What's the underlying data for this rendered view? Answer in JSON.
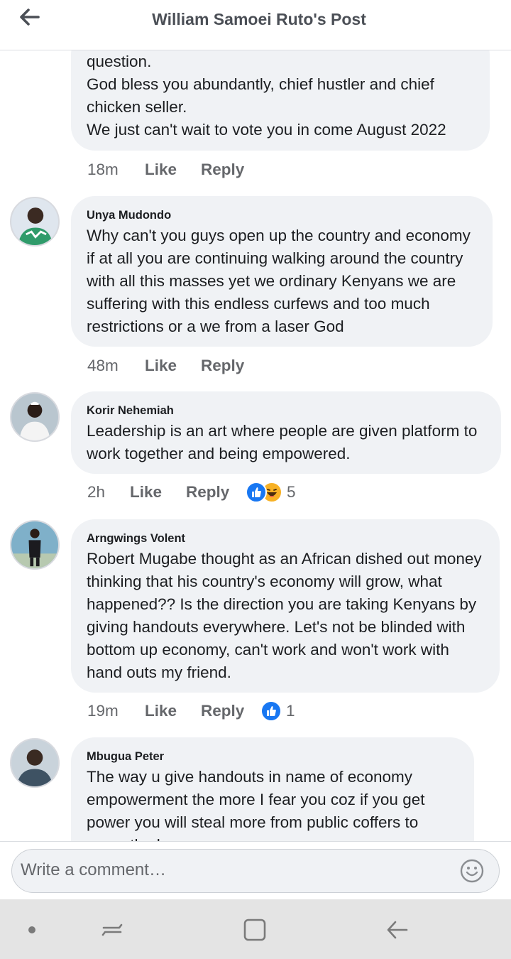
{
  "header": {
    "title": "William Samoei Ruto's Post"
  },
  "comments": [
    {
      "name": "",
      "text": "question.\nGod bless you abundantly, chief hustler and chief chicken seller.\nWe just can't wait to vote you in come August 2022",
      "time": "18m",
      "like": "Like",
      "reply": "Reply",
      "reaction_count": ""
    },
    {
      "name": "Unya Mudondo",
      "text": "Why can't you guys open up the country and economy if at all you are continuing walking around the country with all this masses yet we ordinary Kenyans we are suffering with this endless curfews and too much restrictions or a we from a laser God",
      "time": "48m",
      "like": "Like",
      "reply": "Reply",
      "reaction_count": ""
    },
    {
      "name": "Korir Nehemiah",
      "text": "Leadership is an art where people are given platform to work together and being empowered.",
      "time": "2h",
      "like": "Like",
      "reply": "Reply",
      "reaction_count": "5",
      "reactions": [
        "like-reaction-icon",
        "haha-reaction-icon"
      ]
    },
    {
      "name": "Arngwings Volent",
      "text": "Robert Mugabe thought as an African dished out money thinking that his country's economy will grow, what happened?? Is the direction you are taking Kenyans by giving handouts everywhere. Let's not be blinded with bottom up economy, can't work and won't work with hand outs my friend.",
      "time": "19m",
      "like": "Like",
      "reply": "Reply",
      "reaction_count": "1",
      "reactions": [
        "like-reaction-icon"
      ]
    },
    {
      "name": "Mbugua Peter",
      "text": "The way u give handouts  in name of economy empowerment  the more I fear you coz if you get power you will steal more from public  coffers  to cover the losses",
      "time": "",
      "like": "",
      "reply": "",
      "reaction_count": ""
    }
  ],
  "composer": {
    "placeholder": "Write a comment…"
  },
  "colors": {
    "like_blue": "#1877f2",
    "haha_yellow": "#f7b125",
    "bubble_bg": "#f0f2f5",
    "meta_gray": "#65676b"
  }
}
